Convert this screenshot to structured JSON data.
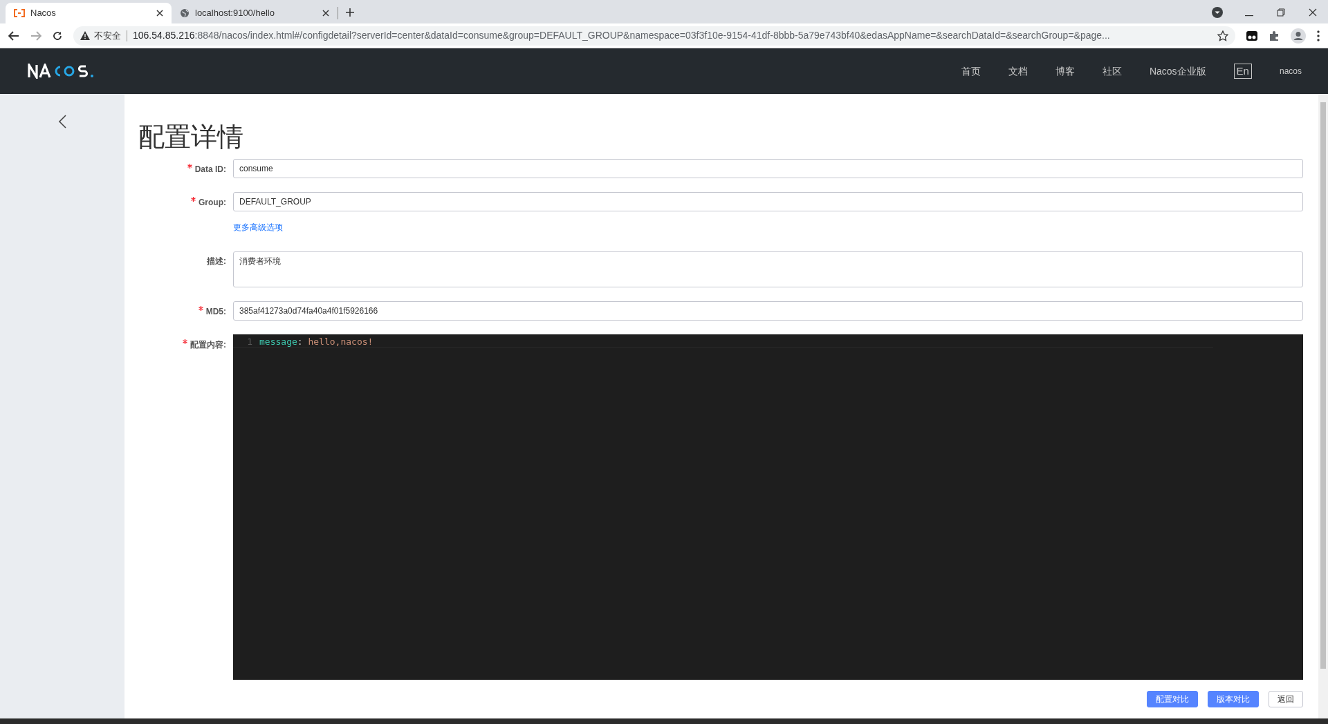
{
  "browser": {
    "tabs": [
      {
        "title": "Nacos",
        "selected": true
      },
      {
        "title": "localhost:9100/hello",
        "selected": false
      }
    ],
    "address": {
      "security": "不安全",
      "host": "106.54.85.216",
      "rest": ":8848/nacos/index.html#/configdetail?serverId=center&dataId=consume&group=DEFAULT_GROUP&namespace=03f3f10e-9154-41df-8bbb-5a79e743bf40&edasAppName=&searchDataId=&searchGroup=&page..."
    }
  },
  "header": {
    "nav": [
      "首页",
      "文档",
      "博客",
      "社区",
      "Nacos企业版"
    ],
    "language": "En",
    "user": "nacos"
  },
  "page": {
    "title": "配置详情",
    "fields": [
      {
        "label": "Data ID:",
        "required": true,
        "value": "consume",
        "kind": "input"
      },
      {
        "label": "Group:",
        "required": true,
        "value": "DEFAULT_GROUP",
        "kind": "input"
      },
      {
        "label": "描述:",
        "required": false,
        "value": "消费者环境",
        "kind": "textarea"
      },
      {
        "label": "MD5:",
        "required": true,
        "value": "385af41273a0d74fa40a4f01f5926166",
        "kind": "input"
      }
    ],
    "advanced_link": "更多高级选项",
    "content": {
      "label": "配置内容:",
      "required": true,
      "lines": [
        {
          "number": "1",
          "key": "message",
          "separator": ": ",
          "value": "hello,nacos!"
        }
      ]
    },
    "buttons": [
      {
        "label": "配置对比",
        "primary": true
      },
      {
        "label": "版本对比",
        "primary": true
      },
      {
        "label": "返回",
        "primary": false
      }
    ]
  }
}
